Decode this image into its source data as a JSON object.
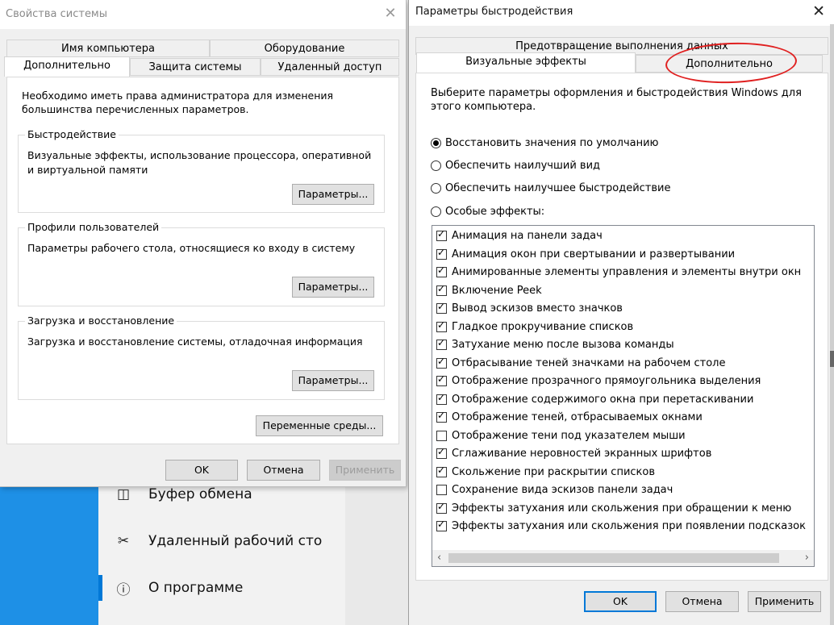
{
  "background_app": {
    "items": [
      {
        "icon": "◫",
        "icon_name": "clipboard-icon",
        "label": "Буфер обмена"
      },
      {
        "icon": "✂",
        "icon_name": "remote-desktop-icon",
        "label": "Удаленный рабочий сто"
      },
      {
        "icon": "ⓘ",
        "icon_name": "info-icon",
        "label": "О программе"
      }
    ]
  },
  "system_properties": {
    "title": "Свойства системы",
    "tabs_row1": [
      "Имя компьютера",
      "Оборудование"
    ],
    "tabs_row2": [
      "Дополнительно",
      "Защита системы",
      "Удаленный доступ"
    ],
    "intro": "Необходимо иметь права администратора для изменения большинства перечисленных параметров.",
    "groups": [
      {
        "title": "Быстродействие",
        "description": "Визуальные эффекты, использование процессора, оперативной и виртуальной памяти",
        "button": "Параметры..."
      },
      {
        "title": "Профили пользователей",
        "description": "Параметры рабочего стола, относящиеся ко входу в систему",
        "button": "Параметры..."
      },
      {
        "title": "Загрузка и восстановление",
        "description": "Загрузка и восстановление системы, отладочная информация",
        "button": "Параметры..."
      }
    ],
    "env_button": "Переменные среды...",
    "ok": "OK",
    "cancel": "Отмена",
    "apply": "Применить"
  },
  "performance_options": {
    "title": "Параметры быстродействия",
    "tab_top": "Предотвращение выполнения данных",
    "tab_visual": "Визуальные эффекты",
    "tab_advanced": "Дополнительно",
    "intro": "Выберите параметры оформления и быстродействия Windows для этого компьютера.",
    "radios": [
      {
        "label": "Восстановить значения по умолчанию",
        "selected": true
      },
      {
        "label": "Обеспечить наилучший вид",
        "selected": false
      },
      {
        "label": "Обеспечить наилучшее быстродействие",
        "selected": false
      },
      {
        "label": "Особые эффекты:",
        "selected": false
      }
    ],
    "effects": [
      {
        "label": "Анимация на панели задач",
        "checked": true
      },
      {
        "label": "Анимация окон при свертывании и развертывании",
        "checked": true
      },
      {
        "label": "Анимированные элементы управления и элементы внутри окн",
        "checked": true
      },
      {
        "label": "Включение Peek",
        "checked": true
      },
      {
        "label": "Вывод эскизов вместо значков",
        "checked": true
      },
      {
        "label": "Гладкое прокручивание списков",
        "checked": true
      },
      {
        "label": "Затухание меню после вызова команды",
        "checked": true
      },
      {
        "label": "Отбрасывание теней значками на рабочем столе",
        "checked": true
      },
      {
        "label": "Отображение прозрачного прямоугольника выделения",
        "checked": true
      },
      {
        "label": "Отображение содержимого окна при перетаскивании",
        "checked": true
      },
      {
        "label": "Отображение теней, отбрасываемых окнами",
        "checked": true
      },
      {
        "label": "Отображение тени под указателем мыши",
        "checked": false
      },
      {
        "label": "Сглаживание неровностей экранных шрифтов",
        "checked": true
      },
      {
        "label": "Скольжение при раскрытии списков",
        "checked": true
      },
      {
        "label": "Сохранение вида эскизов панели задач",
        "checked": false
      },
      {
        "label": "Эффекты затухания или скольжения при обращении к меню",
        "checked": true
      },
      {
        "label": "Эффекты затухания или скольжения при появлении подсказок",
        "checked": true
      }
    ],
    "ok": "OK",
    "cancel": "Отмена",
    "apply": "Применить",
    "annotation_color": "#e02020"
  }
}
